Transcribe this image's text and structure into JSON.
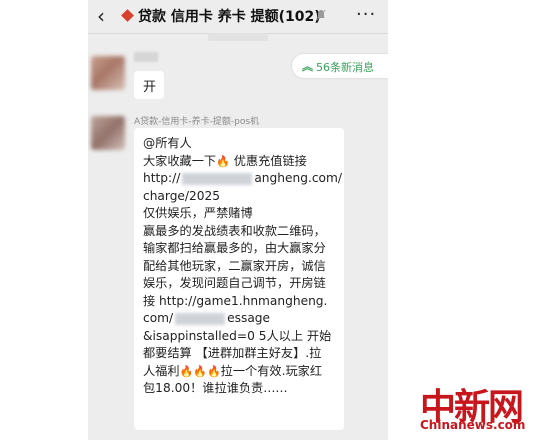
{
  "header": {
    "title": "贷款 信用卡 养卡 提额(102)",
    "back_glyph": "‹",
    "more_glyph": "···"
  },
  "new_messages_label": "56条新消息",
  "messages": [
    {
      "text": "开"
    },
    {
      "sender": "A贷款-信用卡-养卡-提额-pos机",
      "lines": [
        "@所有人",
        "大家收藏一下",
        "优惠充值链接",
        "http://",
        "angheng.com/",
        "charge/2025",
        "仅供娱乐，严禁赌博",
        "赢最多的发战绩表和收款二维码，",
        "输家都扫给赢最多的，由大赢家分",
        "配给其他玩家，二赢家开房，诚信",
        "娱乐，发现问题自己调节，开房链",
        "接 http://game1.hnmangheng.",
        "com/",
        "essage",
        "&isappinstalled=0 5人以上 开始",
        "都要结算 【进群加群主好友】.拉",
        "人福利",
        "拉一个有效.玩家红",
        "包18.00！谁拉谁负责……"
      ]
    }
  ],
  "watermark": {
    "logo": "中新网",
    "site": "Chinanews.com"
  },
  "colors": {
    "accent_green": "#3aa35a",
    "watermark_red": "#c8161d",
    "chat_bg": "#ededed"
  }
}
